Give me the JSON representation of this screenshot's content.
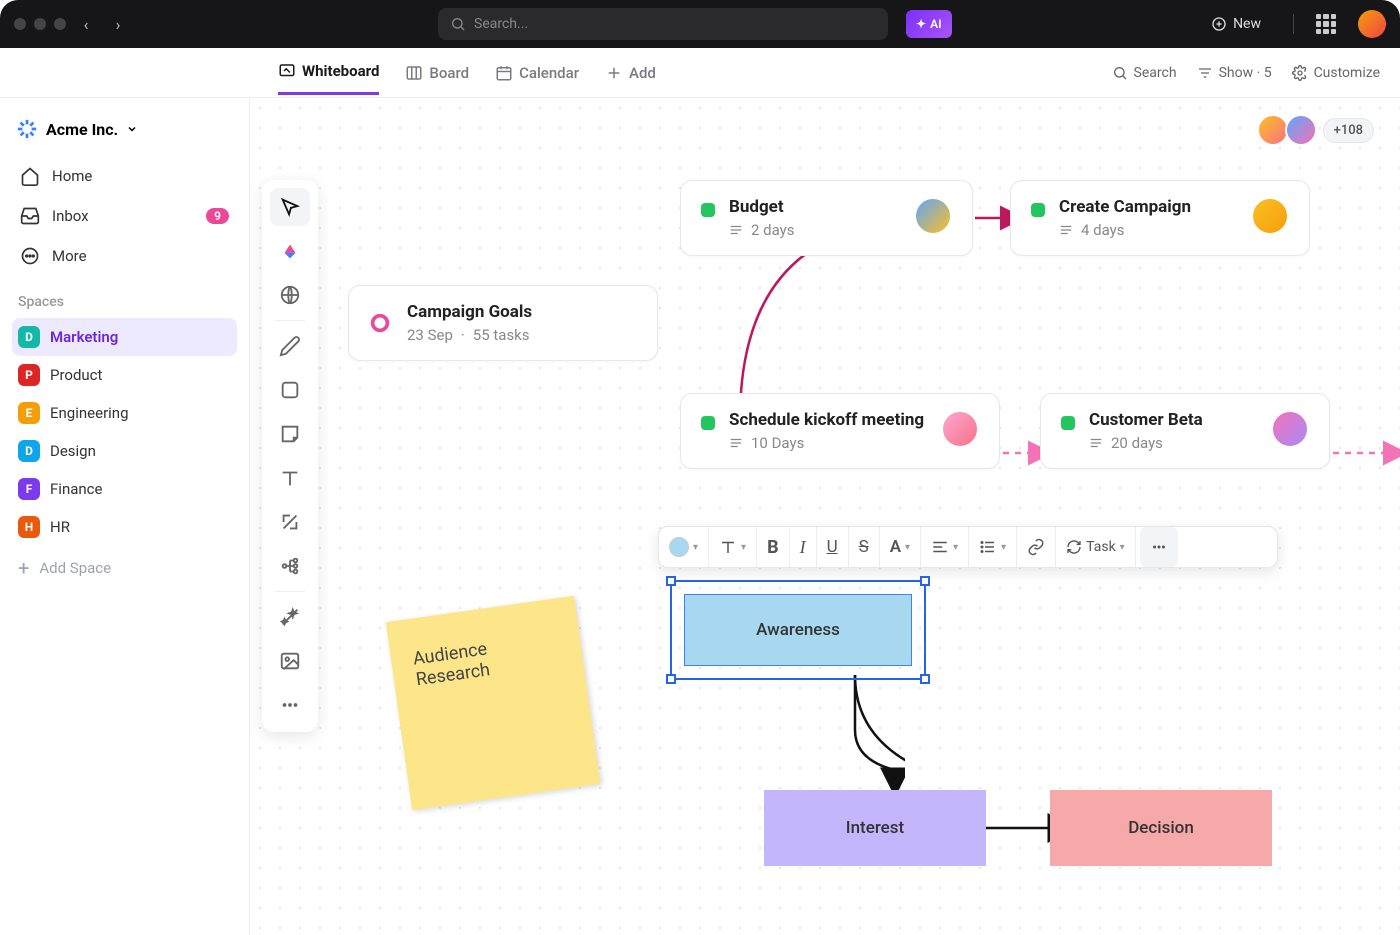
{
  "titlebar": {
    "search_placeholder": "Search...",
    "ai_label": "AI",
    "new_label": "New"
  },
  "workspace": {
    "name": "Acme Inc."
  },
  "nav": {
    "home": "Home",
    "inbox": "Inbox",
    "inbox_count": "9",
    "more": "More"
  },
  "spaces_header": "Spaces",
  "spaces": [
    {
      "letter": "D",
      "color": "#14b8a6",
      "label": "Marketing",
      "active": true
    },
    {
      "letter": "P",
      "color": "#dc2626",
      "label": "Product"
    },
    {
      "letter": "E",
      "color": "#f59e0b",
      "label": "Engineering"
    },
    {
      "letter": "D",
      "color": "#0ea5e9",
      "label": "Design"
    },
    {
      "letter": "F",
      "color": "#7c3aed",
      "label": "Finance"
    },
    {
      "letter": "H",
      "color": "#ea580c",
      "label": "HR"
    }
  ],
  "add_space": "Add Space",
  "tabs": {
    "whiteboard": "Whiteboard",
    "board": "Board",
    "calendar": "Calendar",
    "add": "Add"
  },
  "right": {
    "search": "Search",
    "show": "Show · 5",
    "customize": "Customize"
  },
  "collab_more": "+108",
  "nodes": {
    "goals": {
      "title": "Campaign Goals",
      "date": "23 Sep",
      "tasks": "55 tasks"
    },
    "budget": {
      "title": "Budget",
      "duration": "2 days"
    },
    "campaign": {
      "title": "Create Campaign",
      "duration": "4 days"
    },
    "kickoff": {
      "title": "Schedule kickoff meeting",
      "duration": "10 Days"
    },
    "beta": {
      "title": "Customer Beta",
      "duration": "20 days"
    }
  },
  "sticky": "Audience Research",
  "shapes": {
    "awareness": "Awareness",
    "interest": "Interest",
    "decision": "Decision"
  },
  "minitoolbar": {
    "task": "Task"
  }
}
